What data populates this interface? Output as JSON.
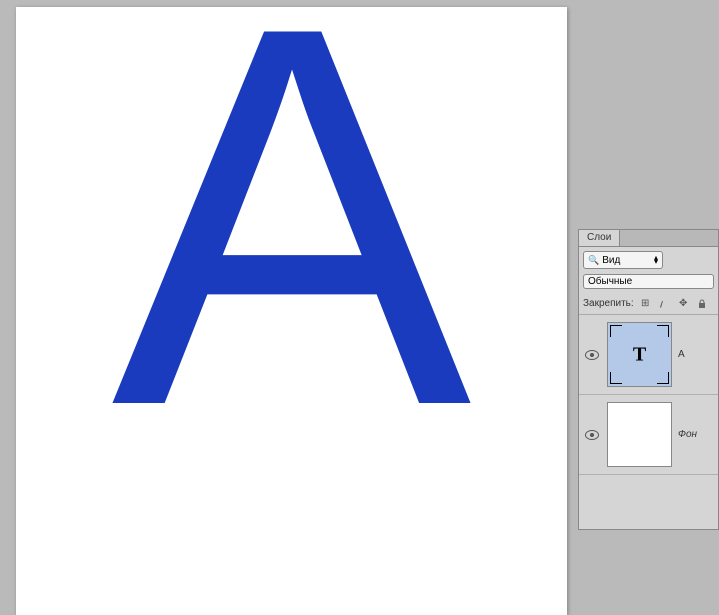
{
  "canvas": {
    "letter": "А",
    "color": "#1a3bbd"
  },
  "panel": {
    "tab_label": "Слои",
    "kind_label": "Вид",
    "blend_mode": "Обычные",
    "lock_label": "Закрепить:"
  },
  "layers": [
    {
      "name": "A",
      "type": "text",
      "thumb_glyph": "T",
      "visible": true,
      "selected": true
    },
    {
      "name": "Фон",
      "type": "background",
      "thumb_glyph": "",
      "visible": true,
      "selected": false
    }
  ]
}
